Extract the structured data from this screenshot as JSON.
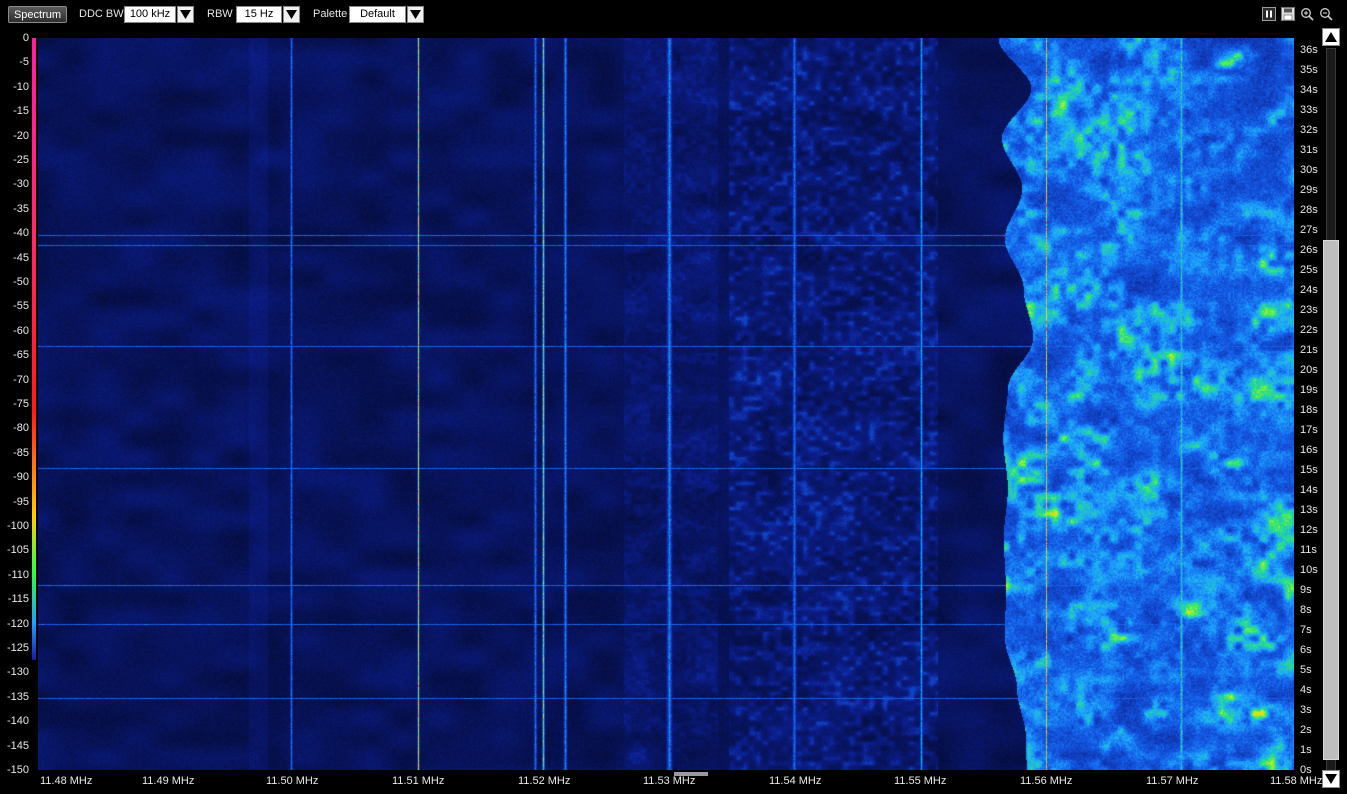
{
  "toolbar": {
    "spectrum_label": "Spectrum",
    "ddc_bw_label": "DDC BW",
    "ddc_bw_value": "100 kHz",
    "rbw_label": "RBW",
    "rbw_value": "15 Hz",
    "palette_label": "Palette",
    "palette_value": "Default"
  },
  "controls": [
    "pause-icon",
    "save-icon",
    "zoom-in-icon",
    "zoom-out-icon"
  ],
  "y_axis": {
    "ticks": [
      "0",
      "-5",
      "-10",
      "-15",
      "-20",
      "-25",
      "-30",
      "-35",
      "-40",
      "-45",
      "-50",
      "-55",
      "-60",
      "-65",
      "-70",
      "-75",
      "-80",
      "-85",
      "-90",
      "-95",
      "-100",
      "-105",
      "-110",
      "-115",
      "-120",
      "-125",
      "-130",
      "-135",
      "-140",
      "-145",
      "-150"
    ]
  },
  "x_axis": {
    "ticks": [
      "11.48 MHz",
      "11.49 MHz",
      "11.50 MHz",
      "11.51 MHz",
      "11.52 MHz",
      "11.53 MHz",
      "11.54 MHz",
      "11.55 MHz",
      "11.56 MHz",
      "11.57 MHz",
      "11.58 MHz"
    ]
  },
  "time_axis": {
    "ticks": [
      "36s",
      "35s",
      "34s",
      "33s",
      "32s",
      "31s",
      "30s",
      "29s",
      "28s",
      "27s",
      "26s",
      "25s",
      "24s",
      "23s",
      "22s",
      "21s",
      "20s",
      "19s",
      "18s",
      "17s",
      "16s",
      "15s",
      "14s",
      "13s",
      "12s",
      "11s",
      "10s",
      "9s",
      "8s",
      "7s",
      "6s",
      "5s",
      "4s",
      "3s",
      "2s",
      "1s",
      "0s"
    ]
  },
  "colors": {
    "background": "#040a30",
    "palette": [
      "#ff1fa0",
      "#ff1a1a",
      "#ffd000",
      "#2aff40",
      "#20a0ff",
      "#1a1aa8"
    ]
  }
}
